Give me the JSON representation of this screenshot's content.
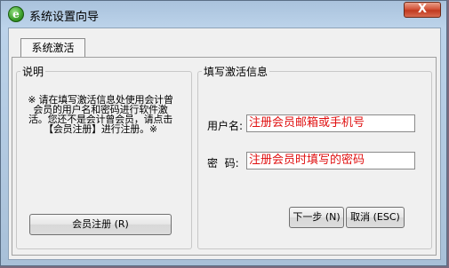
{
  "window": {
    "title": "系统设置向导",
    "app_icon_letter": "e",
    "close_label": "X"
  },
  "tabs": [
    {
      "label": "系统激活"
    }
  ],
  "explanation": {
    "legend": "说明",
    "text": "※ 请在填写激活信息处使用会计曾会员的用户名和密码进行软件激活。您还不是会计曾会员，请点击【会员注册】进行注册。※",
    "register_button": "会员注册 (R)"
  },
  "activation": {
    "legend": "填写激活信息",
    "username_label": "用户名:",
    "username_value": "注册会员邮箱或手机号",
    "password_label": "密  码:",
    "password_value": "注册会员时填写的密码",
    "next_button": "下一步 (N)",
    "cancel_button": "取消 (ESC)"
  }
}
